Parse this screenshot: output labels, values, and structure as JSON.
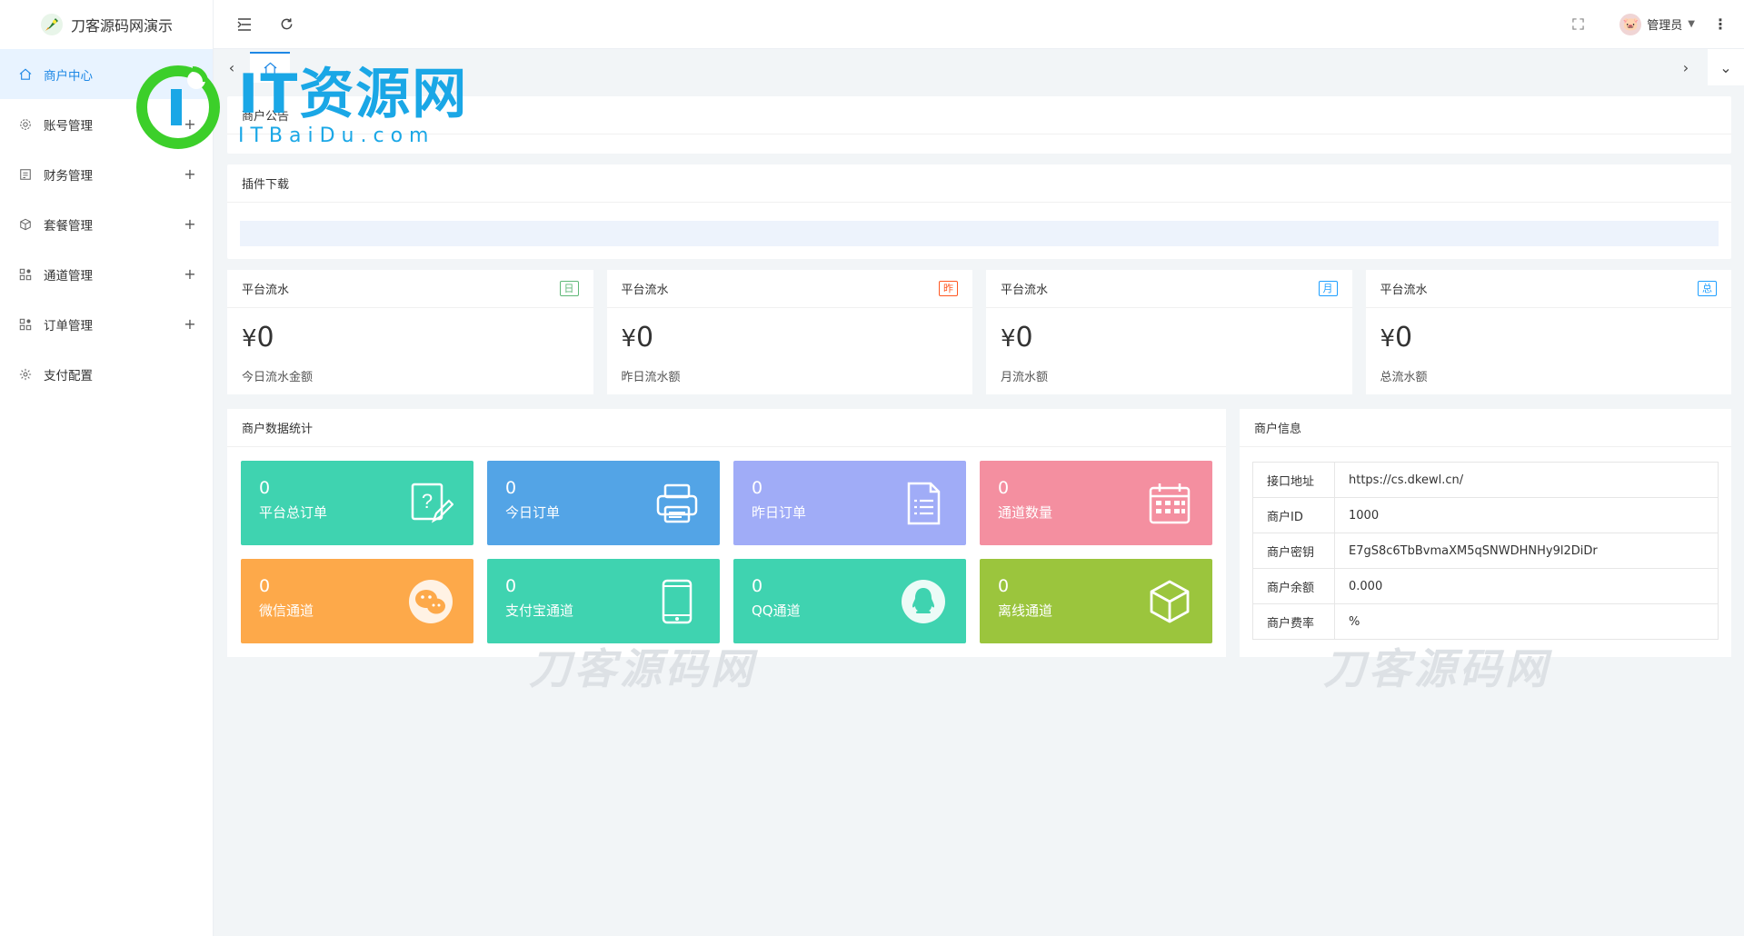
{
  "app": {
    "brand": "刀客源码网演示"
  },
  "sidebar": {
    "items": [
      {
        "label": "商户中心",
        "icon": "home-icon",
        "expandable": false,
        "active": true
      },
      {
        "label": "账号管理",
        "icon": "gear-icon",
        "expandable": true,
        "active": false
      },
      {
        "label": "财务管理",
        "icon": "finance-icon",
        "expandable": true,
        "active": false
      },
      {
        "label": "套餐管理",
        "icon": "package-icon",
        "expandable": true,
        "active": false
      },
      {
        "label": "通道管理",
        "icon": "channel-icon",
        "expandable": true,
        "active": false
      },
      {
        "label": "订单管理",
        "icon": "order-icon",
        "expandable": true,
        "active": false
      },
      {
        "label": "支付配置",
        "icon": "settings-icon",
        "expandable": false,
        "active": false
      }
    ],
    "expand_symbol": "+"
  },
  "header": {
    "admin_name": "管理员"
  },
  "notice": {
    "title": "商户公告"
  },
  "plugin": {
    "title": "插件下载"
  },
  "stats": [
    {
      "title": "平台流水",
      "badge": "日",
      "badge_color": "#5fb878",
      "currency": "¥",
      "value": "0",
      "label": "今日流水金额"
    },
    {
      "title": "平台流水",
      "badge": "昨",
      "badge_color": "#ff5722",
      "currency": "¥",
      "value": "0",
      "label": "昨日流水额"
    },
    {
      "title": "平台流水",
      "badge": "月",
      "badge_color": "#1e9fff",
      "currency": "¥",
      "value": "0",
      "label": "月流水额"
    },
    {
      "title": "平台流水",
      "badge": "总",
      "badge_color": "#1e9fff",
      "currency": "¥",
      "value": "0",
      "label": "总流水额"
    }
  ],
  "merchant_stats": {
    "title": "商户数据统计",
    "tiles": [
      {
        "count": "0",
        "label": "平台总订单",
        "color": "#3fd3b0",
        "icon": "question-edit-icon"
      },
      {
        "count": "0",
        "label": "今日订单",
        "color": "#53a4e6",
        "icon": "printer-icon"
      },
      {
        "count": "0",
        "label": "昨日订单",
        "color": "#a0acf7",
        "icon": "document-list-icon"
      },
      {
        "count": "0",
        "label": "通道数量",
        "color": "#f48fa0",
        "icon": "calendar-icon"
      },
      {
        "count": "0",
        "label": "微信通道",
        "color": "#fda94a",
        "icon": "wechat-icon"
      },
      {
        "count": "0",
        "label": "支付宝通道",
        "color": "#3fd3b0",
        "icon": "tablet-icon"
      },
      {
        "count": "0",
        "label": "QQ通道",
        "color": "#3fd3b0",
        "icon": "qq-icon"
      },
      {
        "count": "0",
        "label": "离线通道",
        "color": "#9bc53d",
        "icon": "cube-icon"
      }
    ]
  },
  "merchant_info": {
    "title": "商户信息",
    "rows": [
      {
        "key": "接口地址",
        "value": "https://cs.dkewl.cn/"
      },
      {
        "key": "商户ID",
        "value": "1000"
      },
      {
        "key": "商户密钥",
        "value": "E7gS8c6TbBvmaXM5qSNWDHNHy9l2DiDr"
      },
      {
        "key": "商户余额",
        "value": "0.000"
      },
      {
        "key": "商户费率",
        "value": "%"
      }
    ]
  },
  "watermarks": {
    "logo_title": "IT资源网",
    "logo_sub": "ITBaiDu.com",
    "ghost": "刀客源码网"
  }
}
